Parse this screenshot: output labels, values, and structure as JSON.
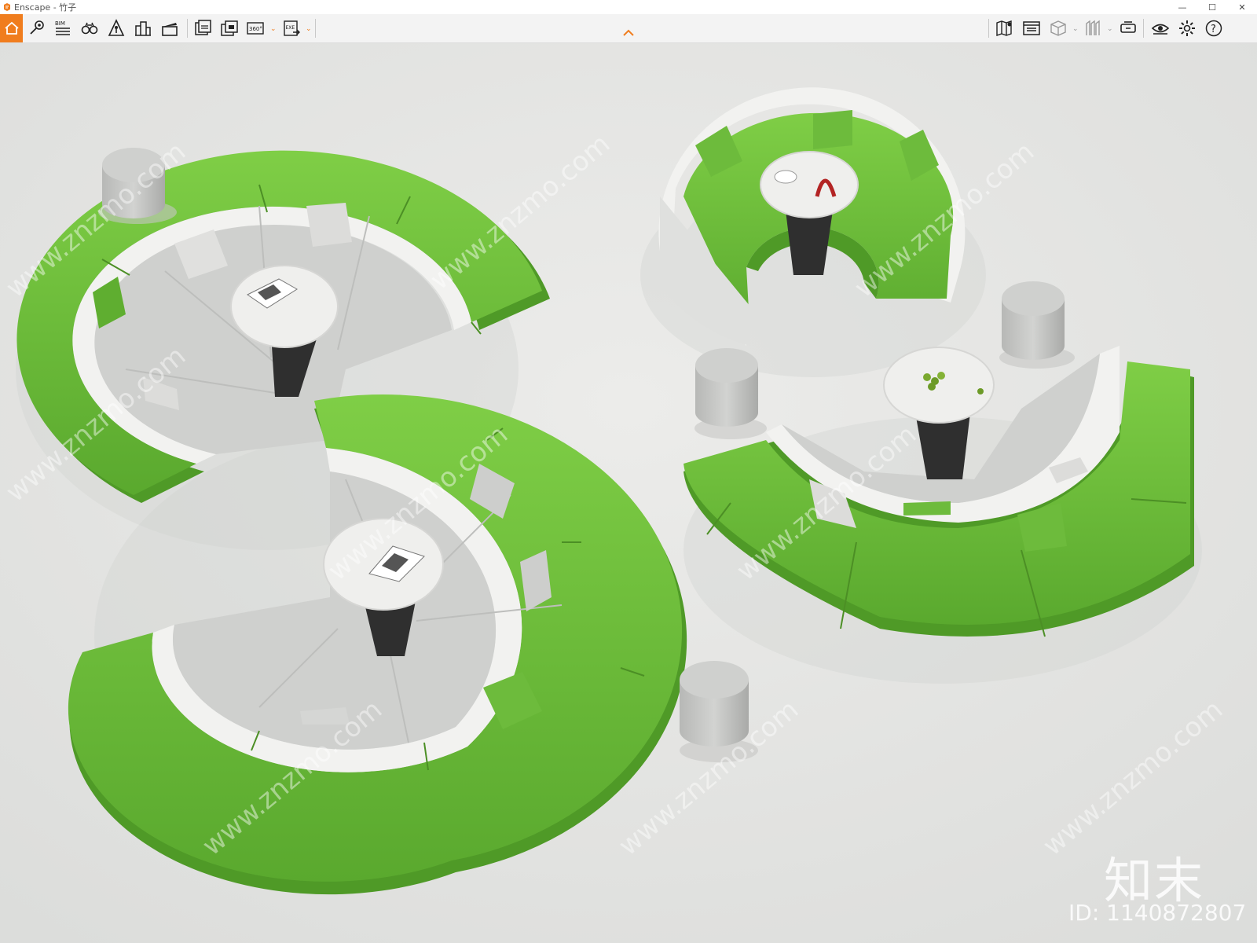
{
  "window": {
    "app_name": "Enscape",
    "title": "Enscape - 竹子"
  },
  "toolbar": {
    "left_icons": [
      "home-icon",
      "camera-path-icon",
      "bim-icon",
      "walk-mode-icon",
      "fly-mode-icon",
      "buildings-icon",
      "clapperboard-icon",
      "screenshot-icon",
      "batch-render-icon",
      "panorama-icon",
      "exe-export-icon"
    ],
    "right_icons": [
      "map-icon",
      "info-panel-icon",
      "cube-icon",
      "asset-library-icon",
      "vr-headset-icon",
      "visual-settings-icon",
      "settings-gear-icon",
      "help-icon"
    ],
    "panorama_label": "360°",
    "exe_label": "EXE",
    "bim_label": "BIM"
  },
  "viewport": {
    "scene": "curved S-shaped modular sofas with round tables and stools",
    "watermark_brand": "知末",
    "watermark_id": "ID: 1140872807",
    "watermark_url": "www.znzmo.com",
    "colors": {
      "sofa_green": "#6dbb3c",
      "sofa_grey": "#cfd0ce",
      "floor": "#e4e5e3",
      "table": "#eeeeec",
      "table_base": "#333333",
      "accent_orange": "#f07d1e"
    }
  }
}
